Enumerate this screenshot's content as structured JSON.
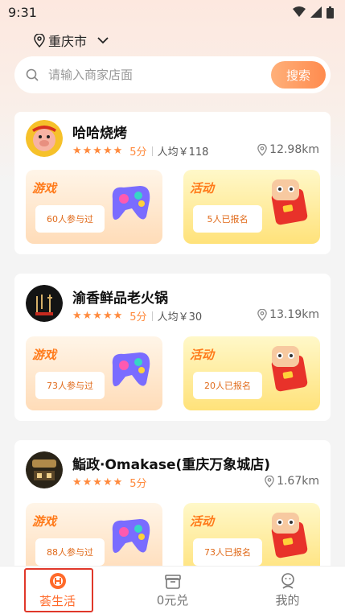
{
  "status": {
    "time": "9:31"
  },
  "location": {
    "city": "重庆市"
  },
  "search": {
    "placeholder": "请输入商家店面",
    "button_label": "搜索"
  },
  "stores": [
    {
      "name": "哈哈烧烤",
      "stars": "★★★★★",
      "score": "5分",
      "avg_price": "人均￥118",
      "distance": "12.98km",
      "game": {
        "title": "游戏",
        "participants": "60人参与过"
      },
      "activity": {
        "title": "活动",
        "signups": "5人已报名"
      }
    },
    {
      "name": "渝香鲜品老火锅",
      "stars": "★★★★★",
      "score": "5分",
      "avg_price": "人均￥30",
      "distance": "13.19km",
      "game": {
        "title": "游戏",
        "participants": "73人参与过"
      },
      "activity": {
        "title": "活动",
        "signups": "20人已报名"
      }
    },
    {
      "name": "鮨政·Omakase(重庆万象城店)",
      "stars": "★★★★★",
      "score": "5分",
      "distance": "1.67km",
      "game": {
        "title": "游戏",
        "participants": "88人参与过"
      },
      "activity": {
        "title": "活动",
        "signups": "73人已报名"
      }
    }
  ],
  "tabs": [
    {
      "label": "荟生活",
      "icon": "logo-circle-icon",
      "active": true
    },
    {
      "label": "0元兑",
      "icon": "gift-box-icon",
      "active": false
    },
    {
      "label": "我的",
      "icon": "user-icon",
      "active": false
    }
  ],
  "colors": {
    "accent": "#ff8a3d",
    "active_tab": "#ff6a2a",
    "highlight": "#e0382a"
  }
}
